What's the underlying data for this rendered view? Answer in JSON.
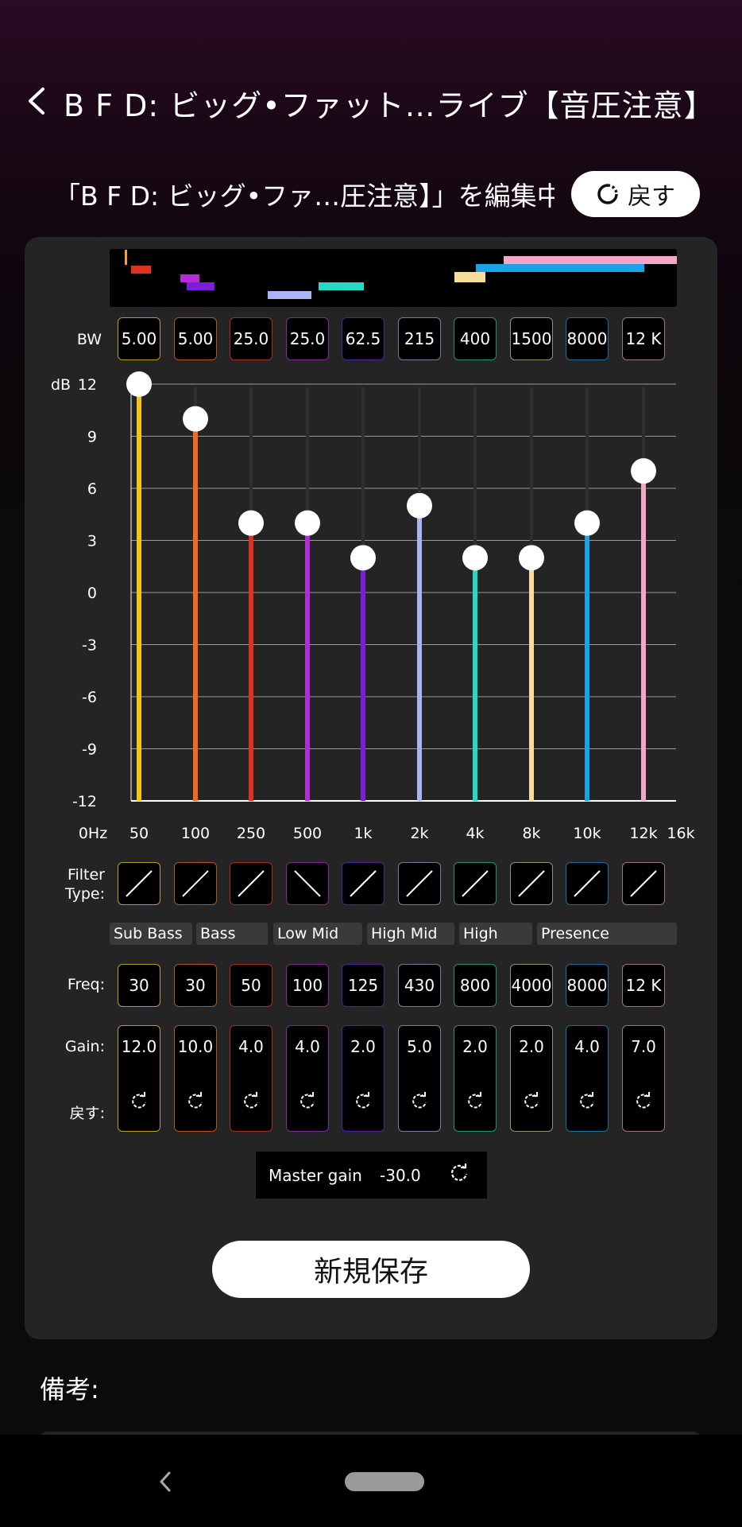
{
  "header": {
    "title": "B F D: ビッグ•ファット…ライブ【音圧注意】"
  },
  "editing": {
    "label": "「B F D: ビッグ•ファ…圧注意】」を編集中",
    "reset_label": "戻す"
  },
  "rows": {
    "bw_label": "BW",
    "filter_type_label": "Filter\nType:",
    "freq_label": "Freq:",
    "gain_label": "Gain:",
    "reset_label": "戻す:"
  },
  "bands": [
    {
      "bw": "5.00",
      "freq": "30",
      "gain": "12.0",
      "filter": "lowshelf",
      "color": "#f5c518",
      "border": "#b99b2a"
    },
    {
      "bw": "5.00",
      "freq": "30",
      "gain": "10.0",
      "filter": "lowshelf",
      "color": "#f26a1b",
      "border": "#b5531f"
    },
    {
      "bw": "25.0",
      "freq": "50",
      "gain": "4.0",
      "filter": "lowshelf",
      "color": "#e0301e",
      "border": "#a3301f"
    },
    {
      "bw": "25.0",
      "freq": "100",
      "gain": "4.0",
      "filter": "highshelf",
      "color": "#b52bd8",
      "border": "#7f2a97"
    },
    {
      "bw": "62.5",
      "freq": "125",
      "gain": "2.0",
      "filter": "lowshelf",
      "color": "#7a1fd8",
      "border": "#52229a"
    },
    {
      "bw": "215",
      "freq": "430",
      "gain": "5.0",
      "filter": "lowshelf",
      "color": "#aab4f5",
      "border": "#767c9c"
    },
    {
      "bw": "400",
      "freq": "800",
      "gain": "2.0",
      "filter": "lowshelf",
      "color": "#25d9c4",
      "border": "#23907f"
    },
    {
      "bw": "1500",
      "freq": "4000",
      "gain": "2.0",
      "filter": "lowshelf",
      "color": "#f7dca0",
      "border": "#9c8e6b"
    },
    {
      "bw": "8000",
      "freq": "8000",
      "gain": "4.0",
      "filter": "lowshelf",
      "color": "#1aa3e6",
      "border": "#1d6f99"
    },
    {
      "bw": "12 K",
      "freq": "12 K",
      "gain": "7.0",
      "filter": "lowshelf",
      "color": "#f4a6c6",
      "border": "#9c7485"
    }
  ],
  "groups": [
    "Sub Bass",
    "Bass",
    "Low Mid",
    "High Mid",
    "High",
    "Presence"
  ],
  "chart_data": {
    "type": "bar",
    "ylabel": "dB",
    "ylim": [
      -12,
      12
    ],
    "yticks": [
      "12",
      "9",
      "6",
      "3",
      "0",
      "-3",
      "-6",
      "-9",
      "-12"
    ],
    "xlabels": [
      "0Hz",
      "50",
      "100",
      "250",
      "500",
      "1k",
      "2k",
      "4k",
      "8k",
      "10k",
      "12k",
      "16k"
    ],
    "values": [
      12,
      10,
      4,
      4,
      2,
      5,
      2,
      2,
      4,
      7
    ]
  },
  "master_gain": {
    "label": "Master gain",
    "value": "-30.0"
  },
  "save_new_label": "新規保存",
  "notes_label": "備考:"
}
